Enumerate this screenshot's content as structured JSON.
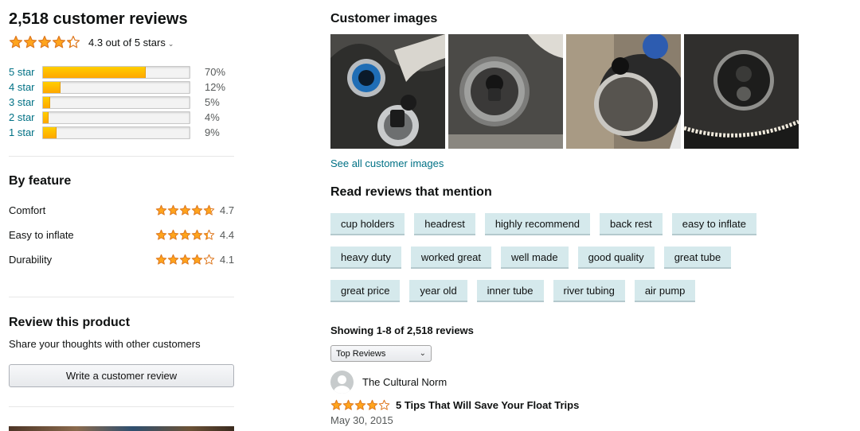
{
  "summary": {
    "total_reviews": "2,518 customer reviews",
    "overall_rating": 4.3,
    "overall_text": "4.3 out of 5 stars"
  },
  "histogram": [
    {
      "label": "5 star",
      "percent": 70,
      "percent_text": "70%"
    },
    {
      "label": "4 star",
      "percent": 12,
      "percent_text": "12%"
    },
    {
      "label": "3 star",
      "percent": 5,
      "percent_text": "5%"
    },
    {
      "label": "2 star",
      "percent": 4,
      "percent_text": "4%"
    },
    {
      "label": "1 star",
      "percent": 9,
      "percent_text": "9%"
    }
  ],
  "by_feature": {
    "title": "By feature",
    "items": [
      {
        "name": "Comfort",
        "rating": 4.7,
        "score": "4.7"
      },
      {
        "name": "Easy to inflate",
        "rating": 4.4,
        "score": "4.4"
      },
      {
        "name": "Durability",
        "rating": 4.1,
        "score": "4.1"
      }
    ]
  },
  "review_product": {
    "title": "Review this product",
    "subtitle": "Share your thoughts with other customers",
    "button": "Write a customer review"
  },
  "customer_images": {
    "title": "Customer images",
    "see_all": "See all customer images"
  },
  "mentions": {
    "title": "Read reviews that mention",
    "rows": [
      [
        "cup holders",
        "headrest",
        "highly recommend",
        "back rest",
        "easy to inflate"
      ],
      [
        "heavy duty",
        "worked great",
        "well made",
        "good quality",
        "great tube"
      ],
      [
        "great price",
        "year old",
        "inner tube",
        "river tubing",
        "air pump"
      ]
    ]
  },
  "reviews": {
    "showing": "Showing 1-8 of 2,518 reviews",
    "sort_selected": "Top Reviews",
    "first": {
      "reviewer": "The Cultural Norm",
      "rating": 4,
      "title": "5 Tips That Will Save Your Float Trips",
      "date": "May 30, 2015"
    }
  },
  "colors": {
    "star": "#ffa41c",
    "star_stroke": "#de7921",
    "link": "#007185",
    "chip_bg": "#d5e9ec"
  }
}
